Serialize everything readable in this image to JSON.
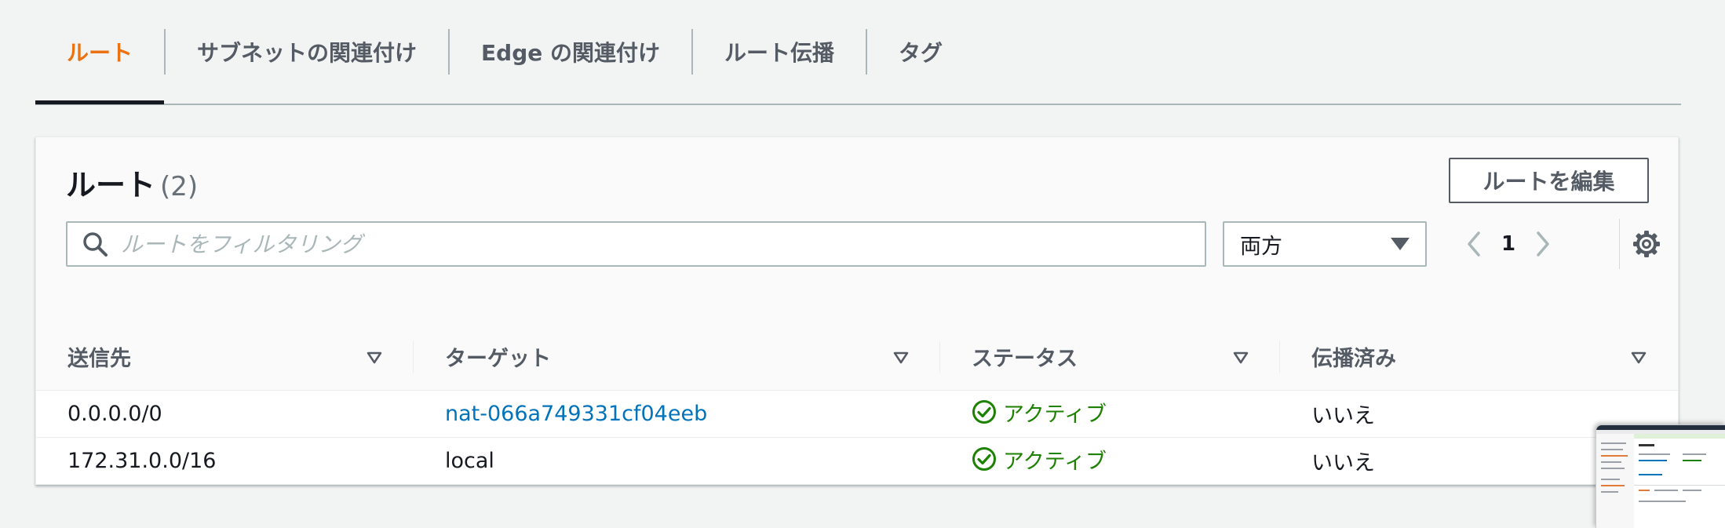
{
  "tabs": [
    {
      "label": "ルート",
      "active": true
    },
    {
      "label": "サブネットの関連付け",
      "active": false
    },
    {
      "label": "Edge の関連付け",
      "active": false
    },
    {
      "label": "ルート伝播",
      "active": false
    },
    {
      "label": "タグ",
      "active": false
    }
  ],
  "panel": {
    "title": "ルート",
    "count": "(2)",
    "edit_button": "ルートを編集",
    "filter_placeholder": "ルートをフィルタリング",
    "select_value": "両方",
    "page": "1"
  },
  "table": {
    "columns": [
      "送信先",
      "ターゲット",
      "ステータス",
      "伝播済み"
    ],
    "rows": [
      {
        "destination": "0.0.0.0/0",
        "target": "nat-066a749331cf04eeb",
        "target_is_link": true,
        "status": "アクティブ",
        "propagated": "いいえ"
      },
      {
        "destination": "172.31.0.0/16",
        "target": "local",
        "target_is_link": false,
        "status": "アクティブ",
        "propagated": "いいえ"
      }
    ]
  },
  "colors": {
    "accent": "#ec7211",
    "link": "#0073bb",
    "success": "#1d8102",
    "background": "#f2f3f3"
  },
  "icons": [
    "search-icon",
    "caret-down-icon",
    "chevron-left-icon",
    "chevron-right-icon",
    "gear-icon",
    "sort-icon",
    "status-check-icon"
  ]
}
